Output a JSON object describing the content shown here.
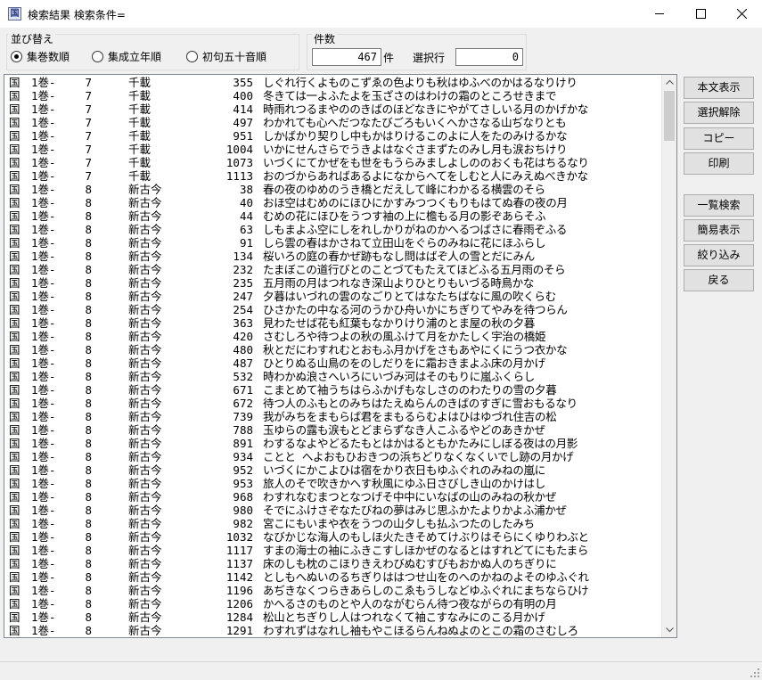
{
  "window": {
    "title": "検索結果 検索条件=",
    "app_icon": "book-icon",
    "controls": [
      "minimize-icon",
      "maximize-icon",
      "close-icon"
    ]
  },
  "sort": {
    "group_label": "並び替え",
    "options": [
      {
        "label": "集巻数順",
        "selected": true
      },
      {
        "label": "集成立年順",
        "selected": false
      },
      {
        "label": "初句五十音順",
        "selected": false
      }
    ]
  },
  "count": {
    "group_label": "件数",
    "total": "467",
    "unit": "件",
    "selected_label": "選択行",
    "selected_value": "0"
  },
  "buttons": {
    "show_text": "本文表示",
    "clear_selection": "選択解除",
    "copy": "コピー",
    "print": "印刷",
    "list_search": "一覧検索",
    "simple_view": "簡易表示",
    "narrow": "絞り込み",
    "back": "戻る"
  },
  "results": [
    {
      "kuni": "国",
      "maki": "1巻-",
      "num": "7",
      "shu": "千載",
      "no": "355",
      "poem": "しぐれ行くよものこずゑの色よりも秋はゆふべのかはるなりけり"
    },
    {
      "kuni": "国",
      "maki": "1巻-",
      "num": "7",
      "shu": "千載",
      "no": "400",
      "poem": "冬きては一よふたよを玉ざさのはわけの霜のところせきまで"
    },
    {
      "kuni": "国",
      "maki": "1巻-",
      "num": "7",
      "shu": "千載",
      "no": "414",
      "poem": "時雨れつるまやののきばのほどなきにやがてさしいる月のかげかな"
    },
    {
      "kuni": "国",
      "maki": "1巻-",
      "num": "7",
      "shu": "千載",
      "no": "497",
      "poem": "わかれても心へだつなたびごろもいくへかさなる山ぢなりとも"
    },
    {
      "kuni": "国",
      "maki": "1巻-",
      "num": "7",
      "shu": "千載",
      "no": "951",
      "poem": "しかばかり契りし中もかはりけるこのよに人をたのみけるかな"
    },
    {
      "kuni": "国",
      "maki": "1巻-",
      "num": "7",
      "shu": "千載",
      "no": "1004",
      "poem": "いかにせんさらでうきよはなぐさまずたのみし月も涙おちけり"
    },
    {
      "kuni": "国",
      "maki": "1巻-",
      "num": "7",
      "shu": "千載",
      "no": "1073",
      "poem": "いづくにてかぜをも世をもうらみましよしののおくも花はちるなり"
    },
    {
      "kuni": "国",
      "maki": "1巻-",
      "num": "7",
      "shu": "千載",
      "no": "1113",
      "poem": "おのづからあればあるよになからへてをしむと人にみえぬべきかな"
    },
    {
      "kuni": "国",
      "maki": "1巻-",
      "num": "8",
      "shu": "新古今",
      "no": "38",
      "poem": "春の夜のゆめのうき橋とだえして峰にわかるる横雲のそら"
    },
    {
      "kuni": "国",
      "maki": "1巻-",
      "num": "8",
      "shu": "新古今",
      "no": "40",
      "poem": "おほ空はむめのにほひにかすみつつくもりもはてぬ春の夜の月"
    },
    {
      "kuni": "国",
      "maki": "1巻-",
      "num": "8",
      "shu": "新古今",
      "no": "44",
      "poem": "むめの花にほひをうつす袖の上に檐もる月の影ぞあらそふ"
    },
    {
      "kuni": "国",
      "maki": "1巻-",
      "num": "8",
      "shu": "新古今",
      "no": "63",
      "poem": "しもまよふ空にしをれしかりがねのかへるつばさに春雨ぞふる"
    },
    {
      "kuni": "国",
      "maki": "1巻-",
      "num": "8",
      "shu": "新古今",
      "no": "91",
      "poem": "しら雲の春はかさねて立田山をぐらのみねに花にほふらし"
    },
    {
      "kuni": "国",
      "maki": "1巻-",
      "num": "8",
      "shu": "新古今",
      "no": "134",
      "poem": "桜いろの庭の春かぜ跡もなし問はばぞ人の雪とだにみん"
    },
    {
      "kuni": "国",
      "maki": "1巻-",
      "num": "8",
      "shu": "新古今",
      "no": "232",
      "poem": "たまぼこの道行びとのことづてもたえてほどふる五月雨のそら"
    },
    {
      "kuni": "国",
      "maki": "1巻-",
      "num": "8",
      "shu": "新古今",
      "no": "235",
      "poem": "五月雨の月はつれなき深山よりひとりもいづる時鳥かな"
    },
    {
      "kuni": "国",
      "maki": "1巻-",
      "num": "8",
      "shu": "新古今",
      "no": "247",
      "poem": "夕暮はいづれの雲のなごりとてはなたちばなに風の吹くらむ"
    },
    {
      "kuni": "国",
      "maki": "1巻-",
      "num": "8",
      "shu": "新古今",
      "no": "254",
      "poem": "ひさかたの中なる河のうかひ舟いかにちぎりてやみを待つらん"
    },
    {
      "kuni": "国",
      "maki": "1巻-",
      "num": "8",
      "shu": "新古今",
      "no": "363",
      "poem": "見わたせば花も紅葉もなかりけり浦のとま屋の秋の夕暮"
    },
    {
      "kuni": "国",
      "maki": "1巻-",
      "num": "8",
      "shu": "新古今",
      "no": "420",
      "poem": "さむしろや待つよの秋の風ふけて月をかたしく宇治の橋姫"
    },
    {
      "kuni": "国",
      "maki": "1巻-",
      "num": "8",
      "shu": "新古今",
      "no": "480",
      "poem": "秋とだにわすれむとおもふ月かげをさもあやにくにうつ衣かな"
    },
    {
      "kuni": "国",
      "maki": "1巻-",
      "num": "8",
      "shu": "新古今",
      "no": "487",
      "poem": "ひとりぬる山鳥のをのしだりをに霜おきまよふ床の月かげ"
    },
    {
      "kuni": "国",
      "maki": "1巻-",
      "num": "8",
      "shu": "新古今",
      "no": "532",
      "poem": "時わかぬ浪さへいろにいづみ河はそのもりに嵐ふくらし"
    },
    {
      "kuni": "国",
      "maki": "1巻-",
      "num": "8",
      "shu": "新古今",
      "no": "671",
      "poem": "こまとめて袖うちはらふかげもなしさののわたりの雪の夕暮"
    },
    {
      "kuni": "国",
      "maki": "1巻-",
      "num": "8",
      "shu": "新古今",
      "no": "672",
      "poem": "待つ人のふもとのみちはたえぬらんのきばのすぎに雪おもるなり"
    },
    {
      "kuni": "国",
      "maki": "1巻-",
      "num": "8",
      "shu": "新古今",
      "no": "739",
      "poem": "我がみちをまもらば君をまもるらむよはひはゆづれ住吉の松"
    },
    {
      "kuni": "国",
      "maki": "1巻-",
      "num": "8",
      "shu": "新古今",
      "no": "788",
      "poem": "玉ゆらの露も涙もとどまらずなき人こふるやどのあきかぜ"
    },
    {
      "kuni": "国",
      "maki": "1巻-",
      "num": "8",
      "shu": "新古今",
      "no": "891",
      "poem": "わするなよやどるたもとはかはるともかたみにしぼる夜はの月影"
    },
    {
      "kuni": "国",
      "maki": "1巻-",
      "num": "8",
      "shu": "新古今",
      "no": "934",
      "poem": "ことと へよおもひおきつの浜ちどりなくなくいでし跡の月かげ"
    },
    {
      "kuni": "国",
      "maki": "1巻-",
      "num": "8",
      "shu": "新古今",
      "no": "952",
      "poem": "いづくにかこよひは宿をかり衣日もゆふぐれのみねの嵐に"
    },
    {
      "kuni": "国",
      "maki": "1巻-",
      "num": "8",
      "shu": "新古今",
      "no": "953",
      "poem": "旅人のそで吹きかへす秋風にゆふ日さびしき山のかけはし"
    },
    {
      "kuni": "国",
      "maki": "1巻-",
      "num": "8",
      "shu": "新古今",
      "no": "968",
      "poem": "わすれなむまつとなつげそ中中にいなばの山のみねの秋かぜ"
    },
    {
      "kuni": "国",
      "maki": "1巻-",
      "num": "8",
      "shu": "新古今",
      "no": "980",
      "poem": "そでにふけさぞなたびねの夢はみじ思ふかたよりかよふ浦かぜ"
    },
    {
      "kuni": "国",
      "maki": "1巻-",
      "num": "8",
      "shu": "新古今",
      "no": "982",
      "poem": "宮こにもいまや衣をうつの山夕しも払ふつたのしたみち"
    },
    {
      "kuni": "国",
      "maki": "1巻-",
      "num": "8",
      "shu": "新古今",
      "no": "1032",
      "poem": "なびかじな海人のもしほ火たきそめてけぶりはそらにくゆりわぶと"
    },
    {
      "kuni": "国",
      "maki": "1巻-",
      "num": "8",
      "shu": "新古今",
      "no": "1117",
      "poem": "すまの海士の袖にふきこすしほかぜのなるとはすれどてにもたまら"
    },
    {
      "kuni": "国",
      "maki": "1巻-",
      "num": "8",
      "shu": "新古今",
      "no": "1137",
      "poem": "床のしも枕のこほりきえわびぬむすびもおかぬ人のちぎりに"
    },
    {
      "kuni": "国",
      "maki": "1巻-",
      "num": "8",
      "shu": "新古今",
      "no": "1142",
      "poem": "としもへぬいのるちぎりははつせ山をのへのかねのよそのゆふぐれ"
    },
    {
      "kuni": "国",
      "maki": "1巻-",
      "num": "8",
      "shu": "新古今",
      "no": "1196",
      "poem": "あぢきなくつらきあらしのこゑもうしなどゆふぐれにまちならひけ"
    },
    {
      "kuni": "国",
      "maki": "1巻-",
      "num": "8",
      "shu": "新古今",
      "no": "1206",
      "poem": "かへるさのものとや人のながむらん待つ夜ながらの有明の月"
    },
    {
      "kuni": "国",
      "maki": "1巻-",
      "num": "8",
      "shu": "新古今",
      "no": "1284",
      "poem": "松山とちぎりし人はつれなくて袖こすなみにのこる月かげ"
    },
    {
      "kuni": "国",
      "maki": "1巻-",
      "num": "8",
      "shu": "新古今",
      "no": "1291",
      "poem": "わすれずはなれし袖もやこほるらんねぬよのとこの霜のさむしろ"
    }
  ]
}
